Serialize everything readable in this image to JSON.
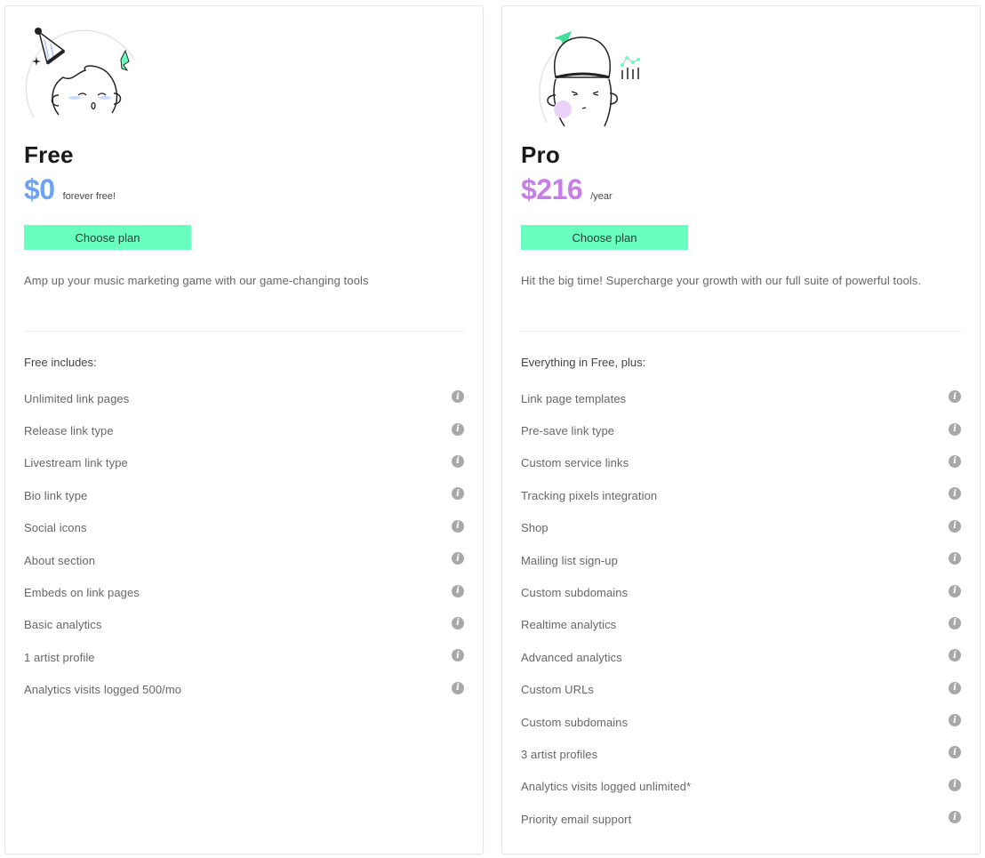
{
  "colors": {
    "free_price": "#6ea3f4",
    "pro_price": "#c77fe6",
    "button_bg": "#69ffbf",
    "info_icon": "#a8a8a8"
  },
  "plans": [
    {
      "id": "free",
      "illustration": "party-hat-character-illustration",
      "name": "Free",
      "price": "$0",
      "price_note": "forever free!",
      "button_label": "Choose plan",
      "description": "Amp up your music marketing game with our game-changing tools",
      "includes_heading": "Free includes:",
      "features": [
        "Unlimited link pages",
        "Release link type",
        "Livestream link type",
        "Bio link type",
        "Social icons",
        "About section",
        "Embeds on link pages",
        "Basic analytics",
        "1 artist profile",
        "Analytics visits logged 500/mo"
      ]
    },
    {
      "id": "pro",
      "illustration": "beanie-character-illustration",
      "name": "Pro",
      "price": "$216",
      "price_note": "/year",
      "button_label": "Choose plan",
      "description": "Hit the big time! Supercharge your growth with our full suite of powerful tools.",
      "includes_heading": "Everything in Free, plus:",
      "features": [
        "Link page templates",
        "Pre-save link type",
        "Custom service links",
        "Tracking pixels integration",
        "Shop",
        "Mailing list sign-up",
        "Custom subdomains",
        "Realtime analytics",
        "Advanced analytics",
        "Custom URLs",
        "Custom subdomains",
        "3 artist profiles",
        "Analytics visits logged unlimited*",
        "Priority email support"
      ]
    }
  ],
  "info_icon_glyph": "i"
}
